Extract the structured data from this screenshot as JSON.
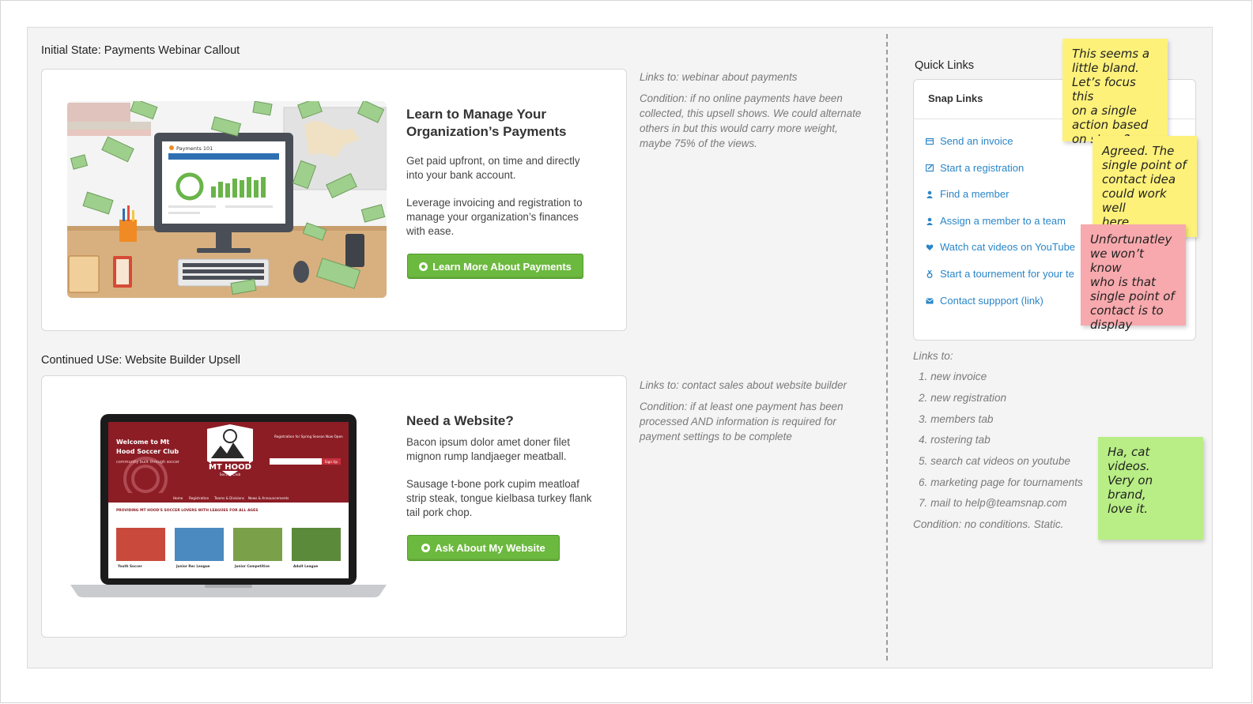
{
  "sections": {
    "payments_title": "Initial State: Payments Webinar Callout",
    "website_title": "Continued USe: Website Builder Upsell"
  },
  "payments_card": {
    "heading_line1": "Learn to Manage Your",
    "heading_line2": "Organization’s Payments",
    "para1_line1": "Get paid upfront, on time and directly",
    "para1_line2": "into your bank account.",
    "para2_line1": "Leverage invoicing and registration to",
    "para2_line2": "manage your organization’s finances",
    "para2_line3": "with ease.",
    "button_label": "Learn More About Payments",
    "screen_label": "Payments 101"
  },
  "payments_notes": {
    "links_to": "Links to: webinar about payments",
    "condition_line1": "Condition: if no online payments have been",
    "condition_line2": "collected, this upsell shows. We could alternate",
    "condition_line3": "others in but this would carry more weight,",
    "condition_line4": "maybe 75% of the views."
  },
  "website_card": {
    "heading": "Need a Website?",
    "para1_line1": "Bacon ipsum dolor amet doner filet",
    "para1_line2": "mignon rump landjaeger meatball.",
    "para2_line1": "Sausage t-bone pork cupim meatloaf",
    "para2_line2": "strip steak, tongue kielbasa turkey flank",
    "para2_line3": "tail pork chop.",
    "button_label": "Ask About My Website",
    "laptop": {
      "welcome_line1": "Welcome to Mt",
      "welcome_line2": "Hood Soccer Club",
      "tagline": "community built through soccer",
      "logo": "MT HOOD",
      "logo_sub": "Soccer Club",
      "reg_line": "Registration for Spring Season Now Open",
      "signup": "Sign Up",
      "nav": [
        "Home",
        "Registration",
        "Teams & Divisions",
        "News & Announcements"
      ],
      "banner": "PROVIDING MT HOOD'S SOCCER LOVERS WITH LEAGUES FOR ALL AGES",
      "tiles": [
        "Youth Soccer",
        "Junior Rec League",
        "Junior Competitive",
        "Adult League"
      ]
    }
  },
  "website_notes": {
    "links_to": "Links to: contact sales about website builder",
    "condition_line1": "Condition: if at least one payment has been",
    "condition_line2": "processed AND information is required for",
    "condition_line3": "payment settings to be complete"
  },
  "quick_links": {
    "title": "Quick Links",
    "panel_title": "Snap Links",
    "items": [
      {
        "label": "Send an invoice",
        "icon": "invoice-icon"
      },
      {
        "label": "Start a registration",
        "icon": "registration-icon"
      },
      {
        "label": "Find a member",
        "icon": "person-icon"
      },
      {
        "label": "Assign a member to a team",
        "icon": "person-icon"
      },
      {
        "label": "Watch cat videos on YouTube",
        "icon": "heart-icon"
      },
      {
        "label": "Start a tournement for your te",
        "icon": "medal-icon"
      },
      {
        "label": "Contact suppport (link)",
        "icon": "envelope-icon"
      }
    ]
  },
  "links_list": {
    "header": "Links to:",
    "items": [
      "1. new invoice",
      "2. new registration",
      "3. members tab",
      "4. rostering tab",
      "5. search cat videos on youtube",
      "6. marketing page for tournaments",
      "7. mail to help@teamsnap.com"
    ],
    "condition": "Condition: no conditions. Static."
  },
  "stickies": {
    "yellow1": [
      "This seems a",
      "little bland.",
      "Let’s focus this",
      "on a single",
      "action based",
      "on stage?"
    ],
    "yellow2": [
      "Agreed. The",
      "single point of",
      "contact idea",
      "could work well",
      "here"
    ],
    "pink": [
      "Unfortunatley",
      "we won’t know",
      "who is that",
      "single point of",
      "contact is to",
      "display"
    ],
    "green": [
      "Ha, cat videos.",
      "Very on brand,",
      "love it."
    ]
  },
  "colors": {
    "accent_green": "#6cb93f",
    "link_blue": "#2a86c8",
    "sticky_yellow": "#fdf17a",
    "sticky_pink": "#f7a9ad",
    "sticky_green": "#b8ee85"
  }
}
